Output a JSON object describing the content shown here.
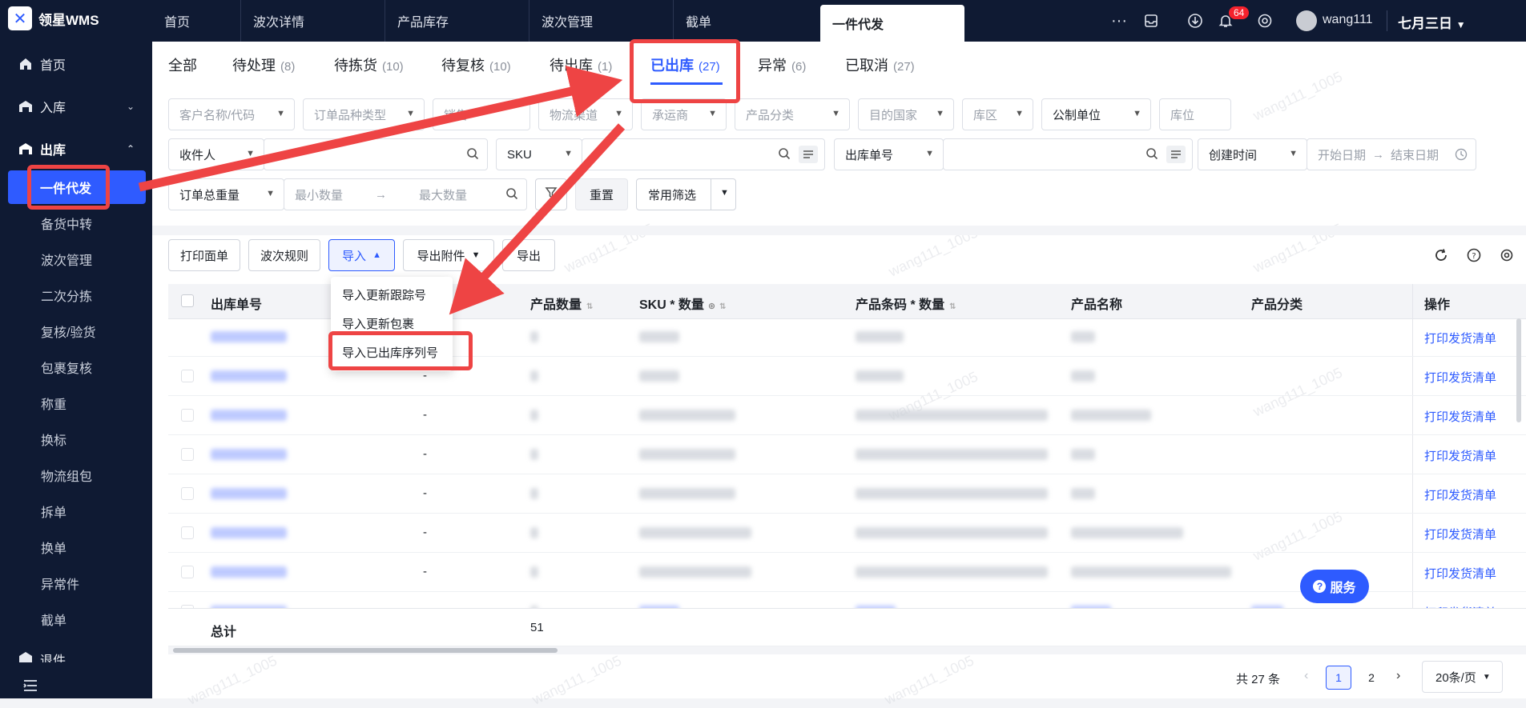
{
  "app": {
    "name": "领星WMS"
  },
  "sidebar": {
    "home": "首页",
    "inbound": "入库",
    "outbound": "出库",
    "active_item": "一件代发",
    "sub_items": [
      "备货中转",
      "波次管理",
      "二次分拣",
      "复核/验货",
      "包裹复核",
      "称重",
      "换标",
      "物流组包",
      "拆单",
      "换单",
      "异常件",
      "截单"
    ],
    "bottom_item": "退件"
  },
  "topbar": {
    "tabs": [
      "首页",
      "波次详情",
      "产品库存",
      "波次管理",
      "截单"
    ],
    "active_tab": "一件代发",
    "notification_count": "64",
    "user": "wang111",
    "brand": "七月三日"
  },
  "status_tabs": [
    {
      "label": "全部",
      "count": ""
    },
    {
      "label": "待处理",
      "count": "(8)"
    },
    {
      "label": "待拣货",
      "count": "(10)"
    },
    {
      "label": "待复核",
      "count": "(10)"
    },
    {
      "label": "待出库",
      "count": "(1)"
    },
    {
      "label": "已出库",
      "count": "(27)"
    },
    {
      "label": "异常",
      "count": "(6)"
    },
    {
      "label": "已取消",
      "count": "(27)"
    }
  ],
  "filters": {
    "row1": [
      "客户名称/代码",
      "订单品种类型",
      "销售",
      "物流渠道",
      "承运商",
      "产品分类",
      "目的国家",
      "库区",
      "公制单位",
      "库位"
    ],
    "recipient": "收件人",
    "sku": "SKU",
    "order_no": "出库单号",
    "created_time": "创建时间",
    "start_date": "开始日期",
    "end_date": "结束日期",
    "total_weight": "订单总重量",
    "min_qty": "最小数量",
    "max_qty": "最大数量",
    "reset": "重置",
    "common_filter": "常用筛选"
  },
  "toolbar": {
    "print_sheet": "打印面单",
    "wave_rule": "波次规则",
    "import": "导入",
    "export_attach": "导出附件",
    "export": "导出"
  },
  "import_menu": [
    "导入更新跟踪号",
    "导入更新包裹",
    "导入已出库序列号"
  ],
  "table": {
    "headers": [
      "出库单号",
      "产品数量",
      "SKU * 数量",
      "产品条码 * 数量",
      "产品名称",
      "产品分类",
      "操作"
    ],
    "action_label": "打印发货清单",
    "dash": "-",
    "total_label": "总计",
    "total_value": "51"
  },
  "pagination": {
    "total": "共 27 条",
    "pages": [
      "1",
      "2"
    ],
    "page_size": "20条/页"
  },
  "service_button": "服务",
  "watermark": "wang111_1005",
  "colors": {
    "accent": "#2e5bff",
    "sidebar": "#0f1a33",
    "highlight": "#ee4444"
  }
}
